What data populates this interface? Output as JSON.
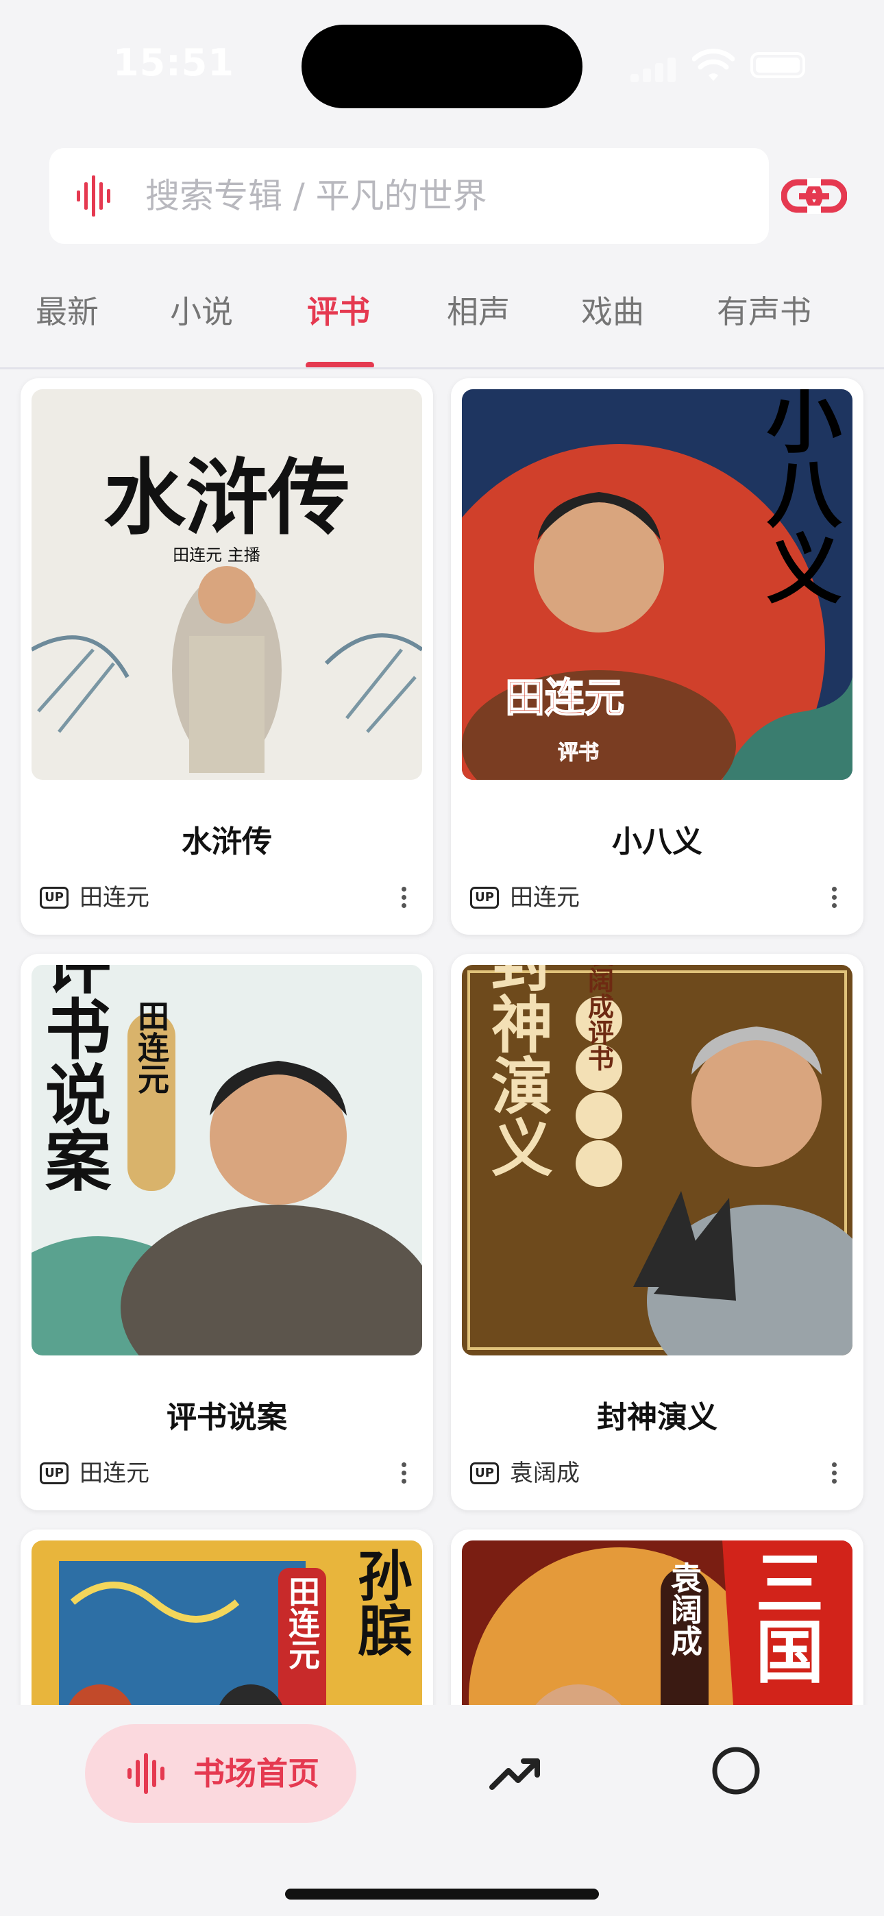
{
  "status_bar": {
    "time": "15:51"
  },
  "search": {
    "placeholder": "搜索专辑 / 平凡的世界"
  },
  "tabs": [
    {
      "label": "最新"
    },
    {
      "label": "小说"
    },
    {
      "label": "评书",
      "active": true
    },
    {
      "label": "相声"
    },
    {
      "label": "戏曲"
    },
    {
      "label": "有声书"
    }
  ],
  "albums": [
    {
      "title": "水浒传",
      "author": "田连元",
      "up_badge": "UP",
      "cover_text": "水浒传",
      "cover_sub": "田连元 主播"
    },
    {
      "title": "小八义",
      "author": "田连元",
      "up_badge": "UP",
      "cover_text": "小八义",
      "cover_sub": "田连元",
      "cover_tag": "评书"
    },
    {
      "title": "评书说案",
      "author": "田连元",
      "up_badge": "UP",
      "cover_text": "评书说案",
      "cover_sub": "田连元"
    },
    {
      "title": "封神演义",
      "author": "袁阔成",
      "up_badge": "UP",
      "cover_text": "封神演义",
      "cover_sub": "袁阔成评书"
    },
    {
      "title": "",
      "author": "",
      "up_badge": "",
      "cover_text": "孙膑",
      "cover_sub": "田连元"
    },
    {
      "title": "",
      "author": "",
      "up_badge": "",
      "cover_text": "三国",
      "cover_sub": "袁阔成"
    }
  ],
  "bottom_nav": {
    "home_label": "书场首页",
    "items": [
      "wave-icon",
      "trending-icon",
      "profile-icon"
    ]
  },
  "colors": {
    "accent": "#e53950",
    "accent_soft": "#fbd9de",
    "background": "#f4f4f6"
  }
}
